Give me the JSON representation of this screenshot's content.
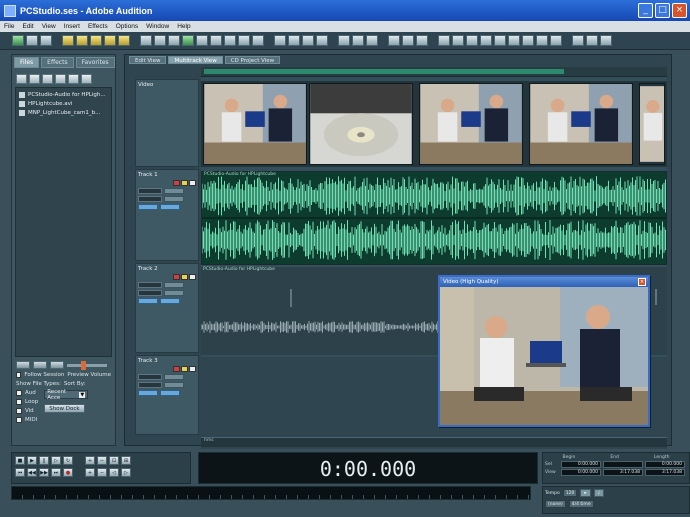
{
  "window": {
    "title": "PCStudio.ses - Adobe Audition"
  },
  "menu": [
    "File",
    "Edit",
    "View",
    "Insert",
    "Effects",
    "Options",
    "Window",
    "Help"
  ],
  "sidebar": {
    "tabs": [
      "Files",
      "Effects",
      "Favorites"
    ],
    "files": [
      "PCStudio-Audio for HPLigh...",
      "HPLightcube.avi",
      "MNP_LightCube_cam1_b..."
    ],
    "follow_label": "Follow Session",
    "preview_volume_label": "Preview Volume",
    "show_file_types_label": "Show File Types:",
    "sort_by_label": "Sort By:",
    "file_types": [
      "Aud",
      "Loop",
      "Vid",
      "MIDI"
    ],
    "sort_value": "Recent Acce",
    "show_dock_button": "Show Dock"
  },
  "views": {
    "tabs": [
      "Edit View",
      "Multitrack View",
      "CD Project View"
    ],
    "active": "Multitrack View"
  },
  "tracks": [
    {
      "name": "Video",
      "type": "video"
    },
    {
      "name": "Track 1",
      "type": "audio",
      "clip": "PCStudio-Audio for HPLightcube"
    },
    {
      "name": "Track 2",
      "type": "audio",
      "clip": "PCStudio-Audio for HPLightcube"
    },
    {
      "name": "Track 3",
      "type": "audio",
      "clip": ""
    }
  ],
  "video_window": {
    "title": "Video (High Quality)"
  },
  "transport": {
    "time": "0:00.000"
  },
  "selection_view": {
    "headers": [
      "Begin",
      "End",
      "Length"
    ],
    "rows": [
      {
        "label": "Sel",
        "begin": "0:00.000",
        "end": "",
        "length": "0:00.000"
      },
      {
        "label": "View",
        "begin": "0:00.000",
        "end": "3:17.038",
        "length": "3:17.038"
      }
    ]
  },
  "status": {
    "tempo_label": "Tempo",
    "tempo_value": "120",
    "time_sig": "4/4 time",
    "key": "(none)"
  }
}
